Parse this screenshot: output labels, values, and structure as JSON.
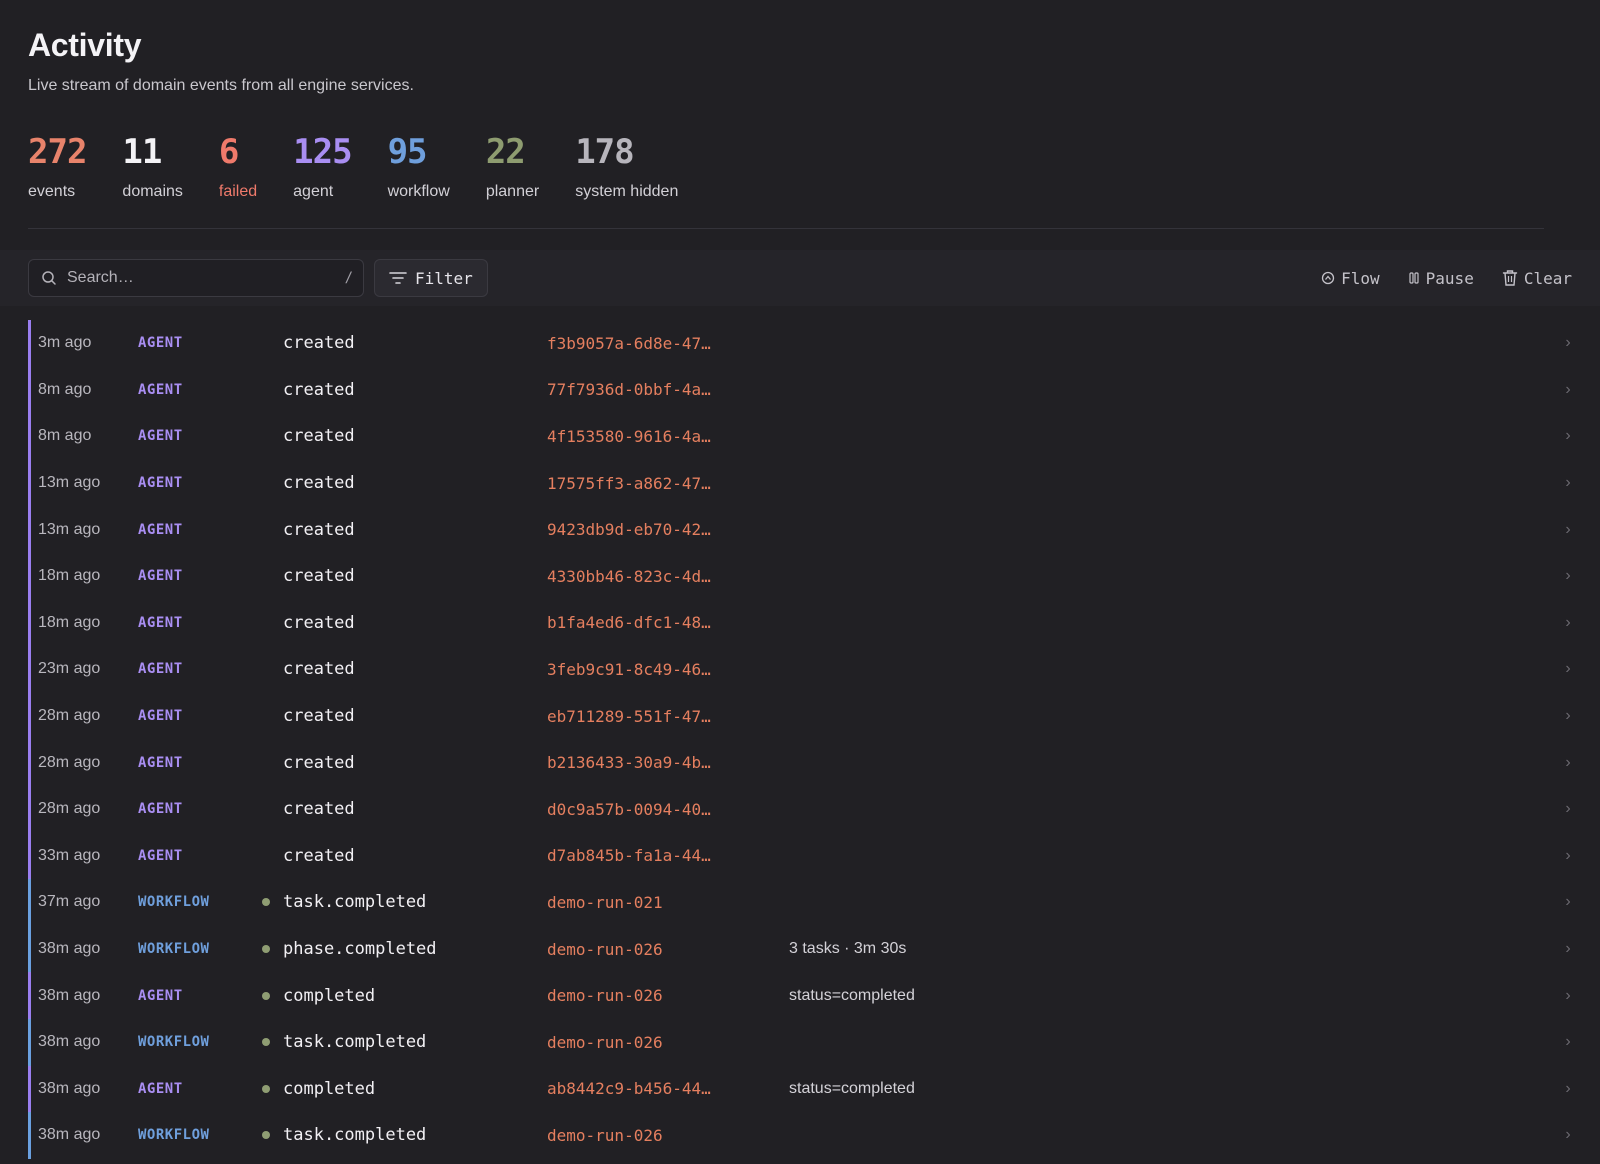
{
  "header": {
    "title": "Activity",
    "subtitle": "Live stream of domain events from all engine services."
  },
  "stats": [
    {
      "value": "272",
      "label": "events",
      "color": "#e8836b",
      "label_color": "#d2d0d6"
    },
    {
      "value": "11",
      "label": "domains",
      "color": "#f4f3f6",
      "label_color": "#d2d0d6"
    },
    {
      "value": "6",
      "label": "failed",
      "color": "#ef7a6b",
      "label_color": "#ef7a6b"
    },
    {
      "value": "125",
      "label": "agent",
      "color": "#a98ef2",
      "label_color": "#d2d0d6"
    },
    {
      "value": "95",
      "label": "workflow",
      "color": "#6f9fdc",
      "label_color": "#d2d0d6"
    },
    {
      "value": "22",
      "label": "planner",
      "color": "#8e9c70",
      "label_color": "#d2d0d6"
    },
    {
      "value": "178",
      "label": "system hidden",
      "color": "#b7b5bc",
      "label_color": "#d2d0d6"
    }
  ],
  "toolbar": {
    "search_placeholder": "Search…",
    "search_shortcut": "/",
    "filter_label": "Filter",
    "flow_label": "Flow",
    "pause_label": "Pause",
    "clear_label": "Clear"
  },
  "colors": {
    "agent": "#a98ef2",
    "workflow": "#6f9fdc",
    "ref": "#e57f5f",
    "dot": "#8f9d73"
  },
  "events": [
    {
      "time": "3m ago",
      "domain": "AGENT",
      "dot": false,
      "event": "created",
      "ref": "f3b9057a-6d8e-47…",
      "detail": ""
    },
    {
      "time": "8m ago",
      "domain": "AGENT",
      "dot": false,
      "event": "created",
      "ref": "77f7936d-0bbf-4a…",
      "detail": ""
    },
    {
      "time": "8m ago",
      "domain": "AGENT",
      "dot": false,
      "event": "created",
      "ref": "4f153580-9616-4a…",
      "detail": ""
    },
    {
      "time": "13m ago",
      "domain": "AGENT",
      "dot": false,
      "event": "created",
      "ref": "17575ff3-a862-47…",
      "detail": ""
    },
    {
      "time": "13m ago",
      "domain": "AGENT",
      "dot": false,
      "event": "created",
      "ref": "9423db9d-eb70-42…",
      "detail": ""
    },
    {
      "time": "18m ago",
      "domain": "AGENT",
      "dot": false,
      "event": "created",
      "ref": "4330bb46-823c-4d…",
      "detail": ""
    },
    {
      "time": "18m ago",
      "domain": "AGENT",
      "dot": false,
      "event": "created",
      "ref": "b1fa4ed6-dfc1-48…",
      "detail": ""
    },
    {
      "time": "23m ago",
      "domain": "AGENT",
      "dot": false,
      "event": "created",
      "ref": "3feb9c91-8c49-46…",
      "detail": ""
    },
    {
      "time": "28m ago",
      "domain": "AGENT",
      "dot": false,
      "event": "created",
      "ref": "eb711289-551f-47…",
      "detail": ""
    },
    {
      "time": "28m ago",
      "domain": "AGENT",
      "dot": false,
      "event": "created",
      "ref": "b2136433-30a9-4b…",
      "detail": ""
    },
    {
      "time": "28m ago",
      "domain": "AGENT",
      "dot": false,
      "event": "created",
      "ref": "d0c9a57b-0094-40…",
      "detail": ""
    },
    {
      "time": "33m ago",
      "domain": "AGENT",
      "dot": false,
      "event": "created",
      "ref": "d7ab845b-fa1a-44…",
      "detail": ""
    },
    {
      "time": "37m ago",
      "domain": "WORKFLOW",
      "dot": true,
      "event": "task.completed",
      "ref": "demo-run-021",
      "detail": ""
    },
    {
      "time": "38m ago",
      "domain": "WORKFLOW",
      "dot": true,
      "event": "phase.completed",
      "ref": "demo-run-026",
      "detail": "3 tasks · 3m 30s"
    },
    {
      "time": "38m ago",
      "domain": "AGENT",
      "dot": true,
      "event": "completed",
      "ref": "demo-run-026",
      "detail": "status=completed"
    },
    {
      "time": "38m ago",
      "domain": "WORKFLOW",
      "dot": true,
      "event": "task.completed",
      "ref": "demo-run-026",
      "detail": ""
    },
    {
      "time": "38m ago",
      "domain": "AGENT",
      "dot": true,
      "event": "completed",
      "ref": "ab8442c9-b456-44…",
      "detail": "status=completed"
    },
    {
      "time": "38m ago",
      "domain": "WORKFLOW",
      "dot": true,
      "event": "task.completed",
      "ref": "demo-run-026",
      "detail": ""
    }
  ]
}
